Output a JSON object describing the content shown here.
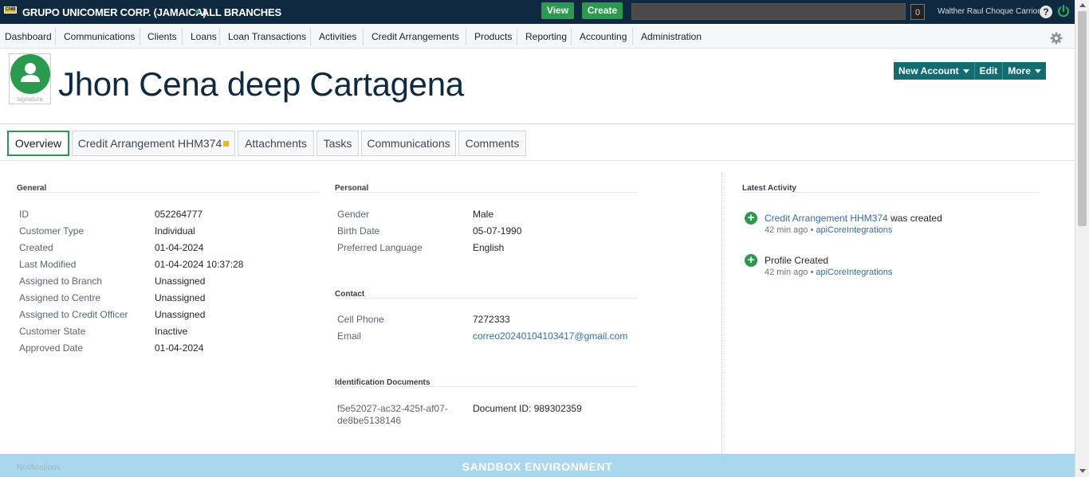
{
  "topbar": {
    "logo_text": "CNB",
    "org_name": "GRUPO UNICOMER CORP. (JAMAICA)",
    "branch": "ALL BRANCHES",
    "view_label": "View",
    "create_label": "Create",
    "search_value": "",
    "notification_count": "0",
    "user_name": "Walther Raul Choque Carrion",
    "help_label": "?"
  },
  "nav": {
    "items": [
      "Dashboard",
      "Communications",
      "Clients",
      "Loans",
      "Loan Transactions",
      "Activities",
      "Credit Arrangements",
      "Products",
      "Reporting",
      "Accounting",
      "Administration"
    ]
  },
  "header": {
    "avatar_caption": "signature",
    "client_name": "Jhon Cena deep Cartagena",
    "actions": [
      "New Account",
      "Edit",
      "More"
    ]
  },
  "tabs": [
    "Overview",
    "Credit Arrangement HHM374",
    "Attachments",
    "Tasks",
    "Communications",
    "Comments"
  ],
  "general": {
    "title": "General",
    "rows": [
      {
        "label": "ID",
        "value": "052264777"
      },
      {
        "label": "Customer Type",
        "value": "Individual"
      },
      {
        "label": "Created",
        "value": "01-04-2024"
      },
      {
        "label": "Last Modified",
        "value": "01-04-2024 10:37:28"
      },
      {
        "label": "Assigned to Branch",
        "value": "Unassigned"
      },
      {
        "label": "Assigned to Centre",
        "value": "Unassigned"
      },
      {
        "label": "Assigned to Credit Officer",
        "value": "Unassigned"
      },
      {
        "label": "Customer State",
        "value": "Inactive"
      },
      {
        "label": "Approved Date",
        "value": "01-04-2024"
      }
    ]
  },
  "personal": {
    "title": "Personal",
    "rows": [
      {
        "label": "Gender",
        "value": "Male"
      },
      {
        "label": "Birth Date",
        "value": "05-07-1990"
      },
      {
        "label": "Preferred Language",
        "value": "English"
      }
    ]
  },
  "contact": {
    "title": "Contact",
    "rows": [
      {
        "label": "Cell Phone",
        "value": "7272333"
      },
      {
        "label": "Email",
        "value": "correo20240104103417@gmail.com"
      }
    ]
  },
  "identification": {
    "title": "Identification Documents",
    "doc_key_line1": "f5e52027-ac32-425f-af07-",
    "doc_key_line2": "de8be5138146",
    "doc_value": "Document ID: 989302359"
  },
  "activity": {
    "title": "Latest Activity",
    "items": [
      {
        "link": "Credit Arrangement HHM374",
        "text": " was created",
        "time": "42 min ago",
        "sep": " • ",
        "user": "apiCoreIntegrations"
      },
      {
        "link": "",
        "text": "Profile Created",
        "time": "42 min ago",
        "sep": " • ",
        "user": "apiCoreIntegrations"
      }
    ]
  },
  "footer": {
    "sandbox_text": "SANDBOX ENVIRONMENT",
    "notifications_label": "Notifications"
  },
  "colors": {
    "topbar_bg": "#0f2940",
    "accent_green": "#2b9a4e",
    "action_teal": "#126c70",
    "link_blue": "#3a6d9c",
    "sandbox_bg": "#a8d7ee",
    "pending_yellow": "#e8b820"
  }
}
